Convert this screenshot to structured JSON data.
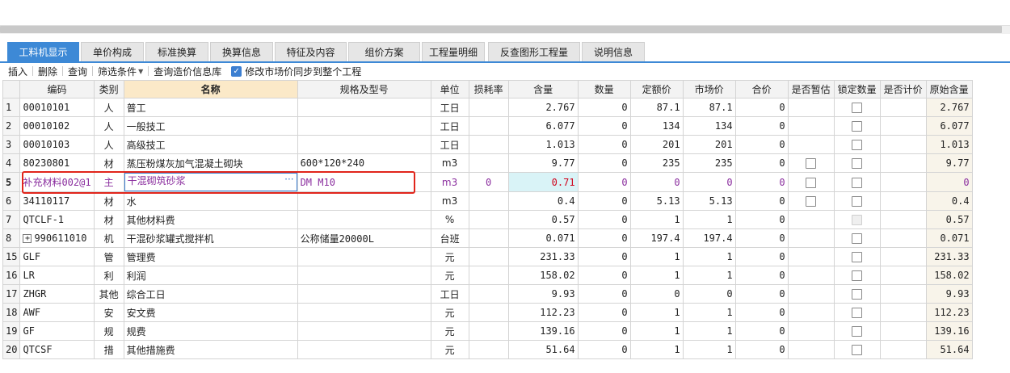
{
  "tabs": [
    {
      "label": "工料机显示",
      "active": true
    },
    {
      "label": "单价构成"
    },
    {
      "label": "标准换算"
    },
    {
      "label": "换算信息"
    },
    {
      "label": "特征及内容"
    },
    {
      "label": "组价方案"
    },
    {
      "label": "工程量明细"
    },
    {
      "label": "反查图形工程量"
    },
    {
      "label": "说明信息"
    }
  ],
  "toolbar": {
    "insert": "插入",
    "delete": "删除",
    "query": "查询",
    "filter": "筛选条件",
    "price_lib": "查询造价信息库",
    "sync_label": "修改市场价同步到整个工程",
    "sync_checked": true
  },
  "columns": [
    "",
    "编码",
    "类别",
    "名称",
    "规格及型号",
    "单位",
    "损耗率",
    "含量",
    "数量",
    "定额价",
    "市场价",
    "合价",
    "是否暂估",
    "锁定数量",
    "是否计价",
    "原始含量"
  ],
  "rows": [
    {
      "no": "1",
      "code": "00010101",
      "type": "人",
      "name": "普工",
      "spec": "",
      "unit": "工日",
      "loss": "",
      "content": "2.767",
      "qty": "0",
      "quota": "87.1",
      "market": "87.1",
      "total": "0",
      "est": false,
      "lock": true,
      "orig": "2.767"
    },
    {
      "no": "2",
      "code": "00010102",
      "type": "人",
      "name": "一般技工",
      "spec": "",
      "unit": "工日",
      "loss": "",
      "content": "6.077",
      "qty": "0",
      "quota": "134",
      "market": "134",
      "total": "0",
      "est": false,
      "lock": true,
      "orig": "6.077"
    },
    {
      "no": "3",
      "code": "00010103",
      "type": "人",
      "name": "高级技工",
      "spec": "",
      "unit": "工日",
      "loss": "",
      "content": "1.013",
      "qty": "0",
      "quota": "201",
      "market": "201",
      "total": "0",
      "est": false,
      "lock": true,
      "orig": "1.013"
    },
    {
      "no": "4",
      "code": "80230801",
      "type": "材",
      "name": "蒸压粉煤灰加气混凝土砌块",
      "spec": "600*120*240",
      "unit": "m3",
      "loss": "",
      "content": "9.77",
      "qty": "0",
      "quota": "235",
      "market": "235",
      "total": "0",
      "est": true,
      "lock": true,
      "orig": "9.77"
    },
    {
      "no": "5",
      "code": "补充材料002@1",
      "type": "主",
      "name": "干混砌筑砂浆",
      "spec": "DM M10",
      "unit": "m3",
      "loss": "0",
      "content": "0.71",
      "qty": "0",
      "quota": "0",
      "market": "0",
      "total": "0",
      "est": true,
      "lock": true,
      "orig": "0",
      "selected": true
    },
    {
      "no": "6",
      "code": "34110117",
      "type": "材",
      "name": "水",
      "spec": "",
      "unit": "m3",
      "loss": "",
      "content": "0.4",
      "qty": "0",
      "quota": "5.13",
      "market": "5.13",
      "total": "0",
      "est": true,
      "lock": true,
      "orig": "0.4"
    },
    {
      "no": "7",
      "code": "QTCLF-1",
      "type": "材",
      "name": "其他材料费",
      "spec": "",
      "unit": "%",
      "loss": "",
      "content": "0.57",
      "qty": "0",
      "quota": "1",
      "market": "1",
      "total": "0",
      "est": false,
      "lock": "disabled",
      "orig": "0.57"
    },
    {
      "no": "8",
      "code": "990611010",
      "type": "机",
      "name": "干混砂浆罐式搅拌机",
      "spec": "公称储量20000L",
      "unit": "台班",
      "loss": "",
      "content": "0.071",
      "qty": "0",
      "quota": "197.4",
      "market": "197.4",
      "total": "0",
      "est": false,
      "lock": true,
      "orig": "0.071",
      "expand": true
    },
    {
      "no": "15",
      "code": "GLF",
      "type": "管",
      "name": "管理费",
      "spec": "",
      "unit": "元",
      "loss": "",
      "content": "231.33",
      "qty": "0",
      "quota": "1",
      "market": "1",
      "total": "0",
      "est": false,
      "lock": true,
      "orig": "231.33"
    },
    {
      "no": "16",
      "code": "LR",
      "type": "利",
      "name": "利润",
      "spec": "",
      "unit": "元",
      "loss": "",
      "content": "158.02",
      "qty": "0",
      "quota": "1",
      "market": "1",
      "total": "0",
      "est": false,
      "lock": true,
      "orig": "158.02"
    },
    {
      "no": "17",
      "code": "ZHGR",
      "type": "其他",
      "name": "综合工日",
      "spec": "",
      "unit": "工日",
      "loss": "",
      "content": "9.93",
      "qty": "0",
      "quota": "0",
      "market": "0",
      "total": "0",
      "est": false,
      "lock": true,
      "orig": "9.93"
    },
    {
      "no": "18",
      "code": "AWF",
      "type": "安",
      "name": "安文费",
      "spec": "",
      "unit": "元",
      "loss": "",
      "content": "112.23",
      "qty": "0",
      "quota": "1",
      "market": "1",
      "total": "0",
      "est": false,
      "lock": true,
      "orig": "112.23"
    },
    {
      "no": "19",
      "code": "GF",
      "type": "规",
      "name": "规费",
      "spec": "",
      "unit": "元",
      "loss": "",
      "content": "139.16",
      "qty": "0",
      "quota": "1",
      "market": "1",
      "total": "0",
      "est": false,
      "lock": true,
      "orig": "139.16"
    },
    {
      "no": "20",
      "code": "QTCSF",
      "type": "措",
      "name": "其他措施费",
      "spec": "",
      "unit": "元",
      "loss": "",
      "content": "51.64",
      "qty": "0",
      "quota": "1",
      "market": "1",
      "total": "0",
      "est": false,
      "lock": true,
      "orig": "51.64"
    }
  ]
}
